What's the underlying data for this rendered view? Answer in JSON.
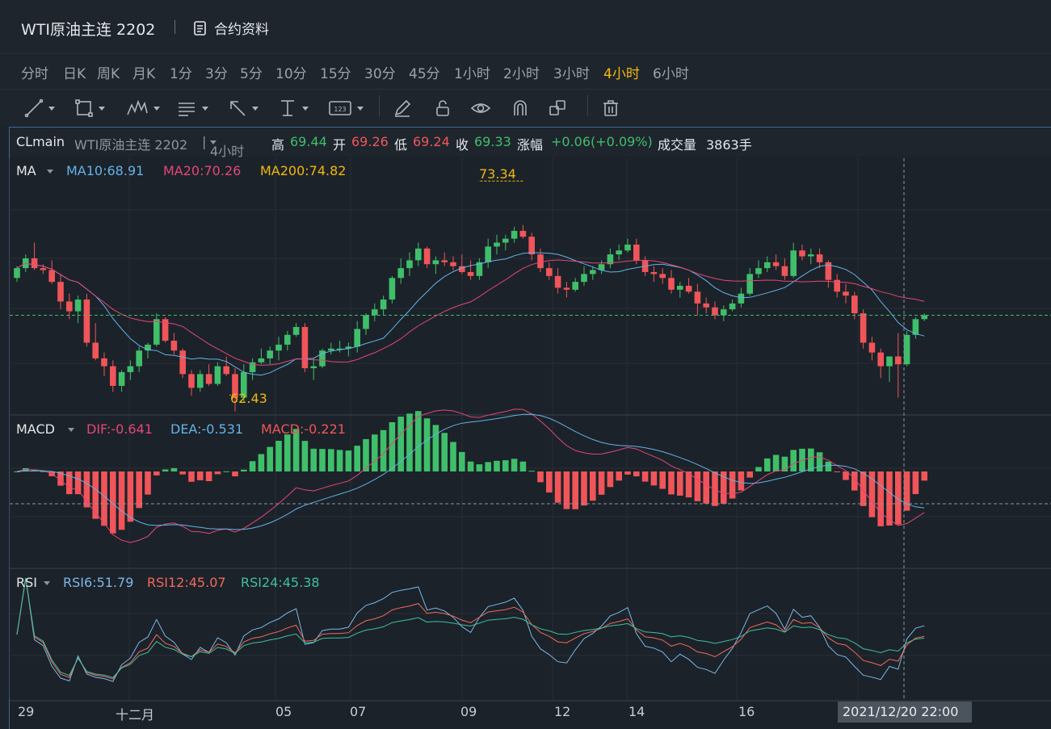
{
  "header": {
    "title": "WTI原油主连 2202",
    "contract_label": "合约资料"
  },
  "periods": [
    {
      "label": "分时",
      "active": false
    },
    {
      "label": "日K",
      "active": false
    },
    {
      "label": "周K",
      "active": false
    },
    {
      "label": "月K",
      "active": false
    },
    {
      "label": "1分",
      "active": false
    },
    {
      "label": "3分",
      "active": false
    },
    {
      "label": "5分",
      "active": false
    },
    {
      "label": "10分",
      "active": false
    },
    {
      "label": "15分",
      "active": false
    },
    {
      "label": "30分",
      "active": false
    },
    {
      "label": "45分",
      "active": false
    },
    {
      "label": "1小时",
      "active": false
    },
    {
      "label": "2小时",
      "active": false
    },
    {
      "label": "3小时",
      "active": false
    },
    {
      "label": "4小时",
      "active": true
    },
    {
      "label": "6小时",
      "active": false
    }
  ],
  "toolbar": {
    "tools": [
      "trend-line-icon",
      "rectangle-icon",
      "pattern-icon",
      "text-icon",
      "arrow-icon",
      "measure-icon",
      "number-icon",
      "pen-icon",
      "lock-icon",
      "eye-icon",
      "magnet-icon",
      "layers-icon",
      "trash-icon"
    ]
  },
  "infobar": {
    "symbol": "CLmain",
    "name": "WTI原油主连 2202",
    "period": "4小时",
    "high_label": "高",
    "high": "69.44",
    "open_label": "开",
    "open": "69.26",
    "low_label": "低",
    "low": "69.24",
    "close_label": "收",
    "close": "69.33",
    "change_label": "涨幅",
    "change": "+0.06(+0.09%)",
    "volume_label": "成交量",
    "volume": "3863手"
  },
  "ma": {
    "label": "MA",
    "ma10": "MA10:68.91",
    "ma20": "MA20:70.26",
    "ma200": "MA200:74.82",
    "high_mark": "73.34",
    "low_mark": "62.43"
  },
  "macd": {
    "label": "MACD",
    "dif": "DIF:-0.641",
    "dea": "DEA:-0.531",
    "macd": "MACD:-0.221"
  },
  "rsi": {
    "label": "RSI",
    "rsi6": "RSI6:51.79",
    "rsi12": "RSI12:45.07",
    "rsi24": "RSI24:45.38"
  },
  "x_axis": [
    "29",
    "十二月",
    "05",
    "07",
    "09",
    "12",
    "14",
    "16"
  ],
  "crosshair_date": "2021/12/20 22:00",
  "colors": {
    "up": "#3fbf6a",
    "down": "#f0555a",
    "ma10": "#62b3e8",
    "ma20": "#e2477a",
    "ma200": "#f0b90b",
    "rsi6": "#7ab8e8",
    "rsi12": "#f06a5a",
    "rsi24": "#3fbfa0",
    "accent": "#f0b90b"
  },
  "chart_data": {
    "type": "candlestick",
    "candles_ohlc": [
      [
        68.4,
        69.0,
        68.2,
        68.9
      ],
      [
        68.9,
        69.6,
        68.7,
        69.4
      ],
      [
        69.4,
        70.2,
        68.8,
        68.9
      ],
      [
        68.9,
        69.1,
        68.6,
        68.8
      ],
      [
        68.8,
        69.3,
        68.1,
        68.2
      ],
      [
        68.2,
        68.6,
        66.8,
        67.2
      ],
      [
        67.2,
        67.6,
        66.3,
        66.7
      ],
      [
        66.7,
        67.5,
        66.1,
        67.3
      ],
      [
        67.3,
        67.6,
        64.9,
        65.1
      ],
      [
        65.1,
        66.1,
        64.2,
        64.3
      ],
      [
        64.3,
        64.6,
        63.4,
        63.9
      ],
      [
        63.9,
        64.2,
        62.6,
        62.9
      ],
      [
        62.9,
        63.7,
        62.6,
        63.6
      ],
      [
        63.6,
        64.2,
        63.2,
        63.9
      ],
      [
        63.9,
        64.9,
        63.6,
        64.7
      ],
      [
        64.7,
        65.1,
        64.3,
        65.0
      ],
      [
        65.0,
        66.6,
        64.9,
        66.3
      ],
      [
        66.3,
        66.4,
        65.1,
        65.2
      ],
      [
        65.2,
        65.6,
        64.5,
        64.7
      ],
      [
        64.7,
        64.8,
        63.3,
        63.5
      ],
      [
        63.5,
        63.7,
        62.4,
        62.8
      ],
      [
        62.8,
        63.7,
        62.6,
        63.5
      ],
      [
        63.5,
        64.0,
        62.9,
        63.0
      ],
      [
        63.0,
        64.1,
        62.9,
        63.9
      ],
      [
        63.9,
        64.4,
        63.4,
        63.5
      ],
      [
        63.5,
        63.8,
        61.6,
        62.3
      ],
      [
        62.3,
        64.0,
        62.1,
        63.6
      ],
      [
        63.6,
        64.3,
        63.2,
        64.1
      ],
      [
        64.1,
        64.8,
        64.0,
        64.3
      ],
      [
        64.3,
        64.9,
        64.0,
        64.7
      ],
      [
        64.7,
        65.4,
        64.2,
        65.0
      ],
      [
        65.0,
        65.7,
        64.7,
        65.5
      ],
      [
        65.5,
        66.1,
        65.4,
        65.9
      ],
      [
        65.9,
        66.1,
        63.6,
        63.8
      ],
      [
        63.8,
        64.3,
        63.2,
        63.9
      ],
      [
        63.9,
        64.8,
        63.8,
        64.7
      ],
      [
        64.7,
        65.1,
        64.5,
        64.8
      ],
      [
        64.8,
        65.2,
        64.6,
        64.8
      ],
      [
        64.8,
        65.1,
        64.4,
        64.9
      ],
      [
        64.9,
        66.2,
        64.6,
        65.8
      ],
      [
        65.8,
        66.6,
        65.5,
        66.5
      ],
      [
        66.5,
        67.1,
        66.2,
        66.8
      ],
      [
        66.8,
        67.5,
        66.5,
        67.3
      ],
      [
        67.3,
        68.5,
        67.1,
        68.4
      ],
      [
        68.4,
        69.4,
        68.1,
        68.9
      ],
      [
        68.9,
        69.7,
        68.5,
        69.3
      ],
      [
        69.3,
        70.2,
        69.0,
        69.9
      ],
      [
        69.9,
        70.0,
        68.9,
        69.1
      ],
      [
        69.1,
        69.5,
        68.6,
        69.3
      ],
      [
        69.3,
        69.7,
        69.0,
        69.2
      ],
      [
        69.2,
        69.5,
        68.8,
        69.0
      ],
      [
        69.0,
        69.6,
        68.6,
        68.7
      ],
      [
        68.7,
        69.3,
        68.3,
        68.5
      ],
      [
        68.5,
        69.4,
        68.3,
        69.2
      ],
      [
        69.2,
        70.4,
        68.9,
        70.0
      ],
      [
        70.0,
        70.6,
        69.6,
        70.2
      ],
      [
        70.2,
        70.6,
        69.8,
        70.4
      ],
      [
        70.4,
        71.0,
        70.2,
        70.8
      ],
      [
        70.8,
        71.1,
        70.4,
        70.5
      ],
      [
        70.5,
        70.7,
        69.3,
        69.6
      ],
      [
        69.6,
        69.9,
        68.7,
        68.9
      ],
      [
        68.9,
        69.2,
        68.3,
        68.5
      ],
      [
        68.5,
        68.9,
        67.6,
        67.9
      ],
      [
        67.9,
        68.2,
        67.4,
        67.8
      ],
      [
        67.8,
        68.4,
        67.7,
        68.2
      ],
      [
        68.2,
        69.0,
        68.0,
        68.6
      ],
      [
        68.6,
        69.0,
        68.3,
        68.8
      ],
      [
        68.8,
        69.3,
        68.6,
        69.1
      ],
      [
        69.1,
        69.9,
        68.9,
        69.6
      ],
      [
        69.6,
        70.1,
        69.3,
        69.8
      ],
      [
        69.8,
        70.4,
        69.7,
        70.1
      ],
      [
        70.1,
        70.4,
        69.1,
        69.3
      ],
      [
        69.3,
        69.5,
        68.5,
        68.7
      ],
      [
        68.7,
        69.0,
        68.2,
        68.6
      ],
      [
        68.6,
        68.9,
        68.1,
        68.4
      ],
      [
        68.4,
        68.8,
        67.6,
        67.8
      ],
      [
        67.8,
        68.2,
        67.4,
        68.0
      ],
      [
        68.0,
        68.4,
        67.6,
        67.7
      ],
      [
        67.7,
        68.1,
        66.5,
        67.1
      ],
      [
        67.1,
        67.4,
        66.6,
        66.9
      ],
      [
        66.9,
        67.2,
        66.3,
        66.5
      ],
      [
        66.5,
        67.0,
        66.2,
        66.8
      ],
      [
        66.8,
        67.3,
        66.7,
        67.1
      ],
      [
        67.1,
        67.9,
        66.9,
        67.6
      ],
      [
        67.6,
        68.9,
        67.5,
        68.6
      ],
      [
        68.6,
        69.3,
        68.4,
        68.9
      ],
      [
        68.9,
        69.5,
        68.7,
        69.2
      ],
      [
        69.2,
        69.6,
        68.8,
        69.0
      ],
      [
        69.0,
        69.4,
        68.3,
        68.5
      ],
      [
        68.5,
        70.2,
        68.4,
        69.8
      ],
      [
        69.8,
        70.1,
        69.3,
        69.5
      ],
      [
        69.5,
        69.9,
        69.1,
        69.6
      ],
      [
        69.6,
        69.9,
        68.9,
        69.2
      ],
      [
        69.2,
        69.3,
        67.9,
        68.3
      ],
      [
        68.3,
        68.6,
        67.4,
        67.7
      ],
      [
        67.7,
        68.1,
        67.1,
        67.5
      ],
      [
        67.5,
        67.7,
        66.3,
        66.6
      ],
      [
        66.6,
        66.8,
        64.8,
        65.1
      ],
      [
        65.1,
        65.4,
        64.2,
        64.6
      ],
      [
        64.6,
        64.8,
        63.3,
        63.9
      ],
      [
        63.9,
        64.3,
        63.1,
        64.4
      ],
      [
        64.4,
        65.6,
        62.3,
        64.0
      ],
      [
        64.0,
        65.7,
        63.9,
        65.5
      ],
      [
        65.5,
        66.4,
        65.3,
        66.3
      ],
      [
        66.3,
        66.6,
        66.2,
        66.5
      ]
    ],
    "ylim": [
      61.5,
      74.5
    ],
    "high_marker": 73.34,
    "low_marker": 62.43
  }
}
